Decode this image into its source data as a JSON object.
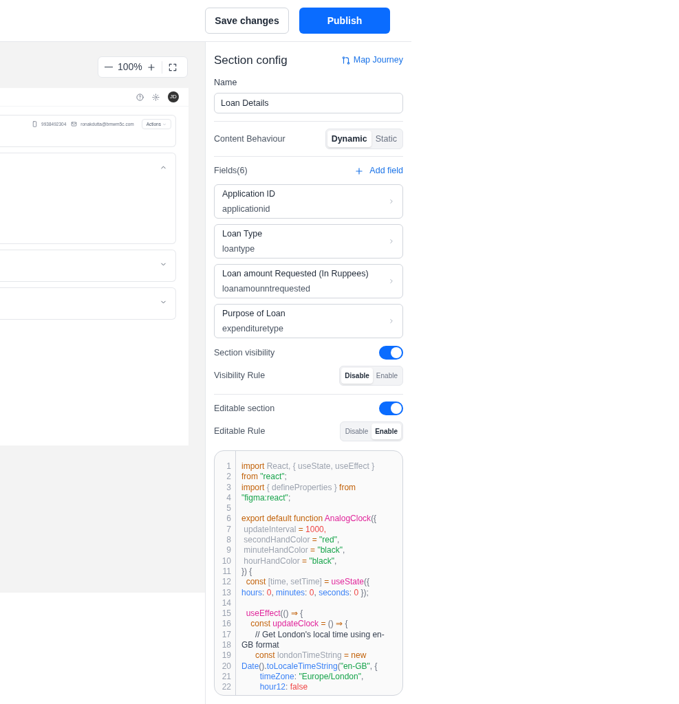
{
  "header": {
    "buttons": [
      {
        "label": "Save changes",
        "kind": "secondary"
      },
      {
        "label": "Publish",
        "kind": "primary"
      }
    ]
  },
  "canvas": {
    "zoom": {
      "value": "100%"
    },
    "preview": {
      "contact": {
        "phone": "9938492304",
        "email": "ronakdutta@bmwm5c.com",
        "actions": "Actions"
      },
      "avatar": "JD",
      "sections": [
        {
          "expanded": true
        },
        {
          "expanded": false
        },
        {
          "expanded": false
        }
      ]
    }
  },
  "panel": {
    "title": "Section config",
    "map_journey": "Map Journey",
    "name_label": "Name",
    "name_value": "Loan Details",
    "content_behaviour": {
      "label": "Content Behaviour",
      "options": [
        {
          "label": "Dynamic",
          "selected": true
        },
        {
          "label": "Static",
          "selected": false
        }
      ]
    },
    "fields_title": "Fields(6)",
    "add_field": "Add field",
    "fields": [
      {
        "label": "Application ID",
        "key": "applicationid"
      },
      {
        "label": "Loan Type",
        "key": "loantype"
      },
      {
        "label": "Loan amount Requested (In Ruppees)",
        "key": "loanamounntrequested"
      },
      {
        "label": "Purpose of Loan",
        "key": "expendituretype"
      }
    ],
    "settings": [
      {
        "toggle_label": "Section visibility",
        "on": true,
        "rule_label": "Visibility Rule",
        "options": [
          {
            "label": "Disable",
            "selected": true
          },
          {
            "label": "Enable",
            "selected": false
          }
        ]
      },
      {
        "toggle_label": "Editable section",
        "on": true,
        "rule_label": "Editable Rule",
        "options": [
          {
            "label": "Disable",
            "selected": false
          },
          {
            "label": "Enable",
            "selected": true
          }
        ]
      }
    ],
    "code": [
      {
        "n": "1",
        "tokens": [
          {
            "kind": "kw",
            "text": "import"
          },
          {
            "kind": "var",
            "text": " React, { useState, useEffect }"
          }
        ]
      },
      {
        "n": "2",
        "tokens": [
          {
            "kind": "kw",
            "text": "from "
          },
          {
            "kind": "str",
            "text": "\"react\""
          },
          {
            "kind": "punct",
            "text": ";"
          }
        ]
      },
      {
        "n": "3",
        "tokens": [
          {
            "kind": "kw",
            "text": "import"
          },
          {
            "kind": "var",
            "text": " { defineProperties } "
          },
          {
            "kind": "kw",
            "text": "from"
          }
        ]
      },
      {
        "n": "4",
        "tokens": [
          {
            "kind": "str",
            "text": "\"figma:react\""
          },
          {
            "kind": "punct",
            "text": ";"
          }
        ]
      },
      {
        "n": "5"
      },
      {
        "n": "6",
        "tokens": [
          {
            "kind": "kw",
            "text": "export default function "
          },
          {
            "kind": "fn",
            "text": "AnalogClock"
          },
          {
            "kind": "punct",
            "text": "({"
          }
        ]
      },
      {
        "n": "7",
        "tokens": [
          {
            "kind": "var",
            "text": " updateInterval "
          },
          {
            "kind": "kw",
            "text": "= "
          },
          {
            "kind": "num",
            "text": "1000,"
          }
        ]
      },
      {
        "n": "8",
        "tokens": [
          {
            "kind": "var",
            "text": " secondHandColor "
          },
          {
            "kind": "kw",
            "text": "= "
          },
          {
            "kind": "str",
            "text": "\"red\""
          },
          {
            "kind": "punct",
            "text": ","
          }
        ]
      },
      {
        "n": "9",
        "tokens": [
          {
            "kind": "var",
            "text": " minuteHandColor "
          },
          {
            "kind": "kw",
            "text": "= "
          },
          {
            "kind": "str",
            "text": "\"black\""
          },
          {
            "kind": "punct",
            "text": ","
          }
        ]
      },
      {
        "n": "10",
        "tokens": [
          {
            "kind": "var",
            "text": " hourHandColor "
          },
          {
            "kind": "kw",
            "text": "= "
          },
          {
            "kind": "str",
            "text": "\"black\""
          },
          {
            "kind": "punct",
            "text": ","
          }
        ]
      },
      {
        "n": "11",
        "tokens": [
          {
            "kind": "punct",
            "text": "}) {"
          }
        ]
      },
      {
        "n": "12",
        "tokens": [
          {
            "kind": "kw",
            "text": "  const "
          },
          {
            "kind": "var",
            "text": "[time, setTime] "
          },
          {
            "kind": "kw",
            "text": "= "
          },
          {
            "kind": "fn",
            "text": "useState"
          },
          {
            "kind": "punct",
            "text": "({"
          }
        ]
      },
      {
        "n": "13",
        "tokens": [
          {
            "kind": "prop",
            "text": "hours"
          },
          {
            "kind": "punct",
            "text": ": "
          },
          {
            "kind": "num",
            "text": "0"
          },
          {
            "kind": "punct",
            "text": ", "
          },
          {
            "kind": "prop",
            "text": "minutes"
          },
          {
            "kind": "punct",
            "text": ": "
          },
          {
            "kind": "num",
            "text": "0"
          },
          {
            "kind": "punct",
            "text": ", "
          },
          {
            "kind": "prop",
            "text": "seconds"
          },
          {
            "kind": "punct",
            "text": ": "
          },
          {
            "kind": "num",
            "text": "0"
          },
          {
            "kind": "punct",
            "text": " });"
          }
        ]
      },
      {
        "n": "14"
      },
      {
        "n": "15",
        "tokens": [
          {
            "kind": "fn",
            "text": "  useEffect"
          },
          {
            "kind": "punct",
            "text": "(() "
          },
          {
            "kind": "kw",
            "text": "⇒ "
          },
          {
            "kind": "punct",
            "text": "{"
          }
        ]
      },
      {
        "n": "16",
        "tokens": [
          {
            "kind": "kw",
            "text": "    const "
          },
          {
            "kind": "fn",
            "text": "updateClock"
          },
          {
            "kind": "kw",
            "text": " = "
          },
          {
            "kind": "punct",
            "text": "() "
          },
          {
            "kind": "kw",
            "text": "⇒ "
          },
          {
            "kind": "punct",
            "text": "{"
          }
        ]
      },
      {
        "n": "17",
        "tokens": [
          {
            "kind": "comment",
            "text": "      // Get London's local time using en-"
          }
        ]
      },
      {
        "n": "18",
        "tokens": [
          {
            "kind": "comment",
            "text": "GB format"
          }
        ]
      },
      {
        "n": "19",
        "tokens": [
          {
            "kind": "kw",
            "text": "      const "
          },
          {
            "kind": "var",
            "text": "londonTimeString "
          },
          {
            "kind": "kw",
            "text": "= new"
          }
        ]
      },
      {
        "n": "20",
        "tokens": [
          {
            "kind": "prop",
            "text": "Date"
          },
          {
            "kind": "punct",
            "text": "()."
          },
          {
            "kind": "prop",
            "text": "toLocaleTimeString"
          },
          {
            "kind": "punct",
            "text": "("
          },
          {
            "kind": "str",
            "text": "\"en-GB\""
          },
          {
            "kind": "punct",
            "text": ", {"
          }
        ]
      },
      {
        "n": "21",
        "tokens": [
          {
            "kind": "prop",
            "text": "        timeZone"
          },
          {
            "kind": "punct",
            "text": ": "
          },
          {
            "kind": "str",
            "text": "\"Europe/London\""
          },
          {
            "kind": "punct",
            "text": ","
          }
        ]
      },
      {
        "n": "22",
        "tokens": [
          {
            "kind": "prop",
            "text": "        hour12"
          },
          {
            "kind": "punct",
            "text": ": "
          },
          {
            "kind": "num",
            "text": "false"
          }
        ]
      }
    ]
  }
}
